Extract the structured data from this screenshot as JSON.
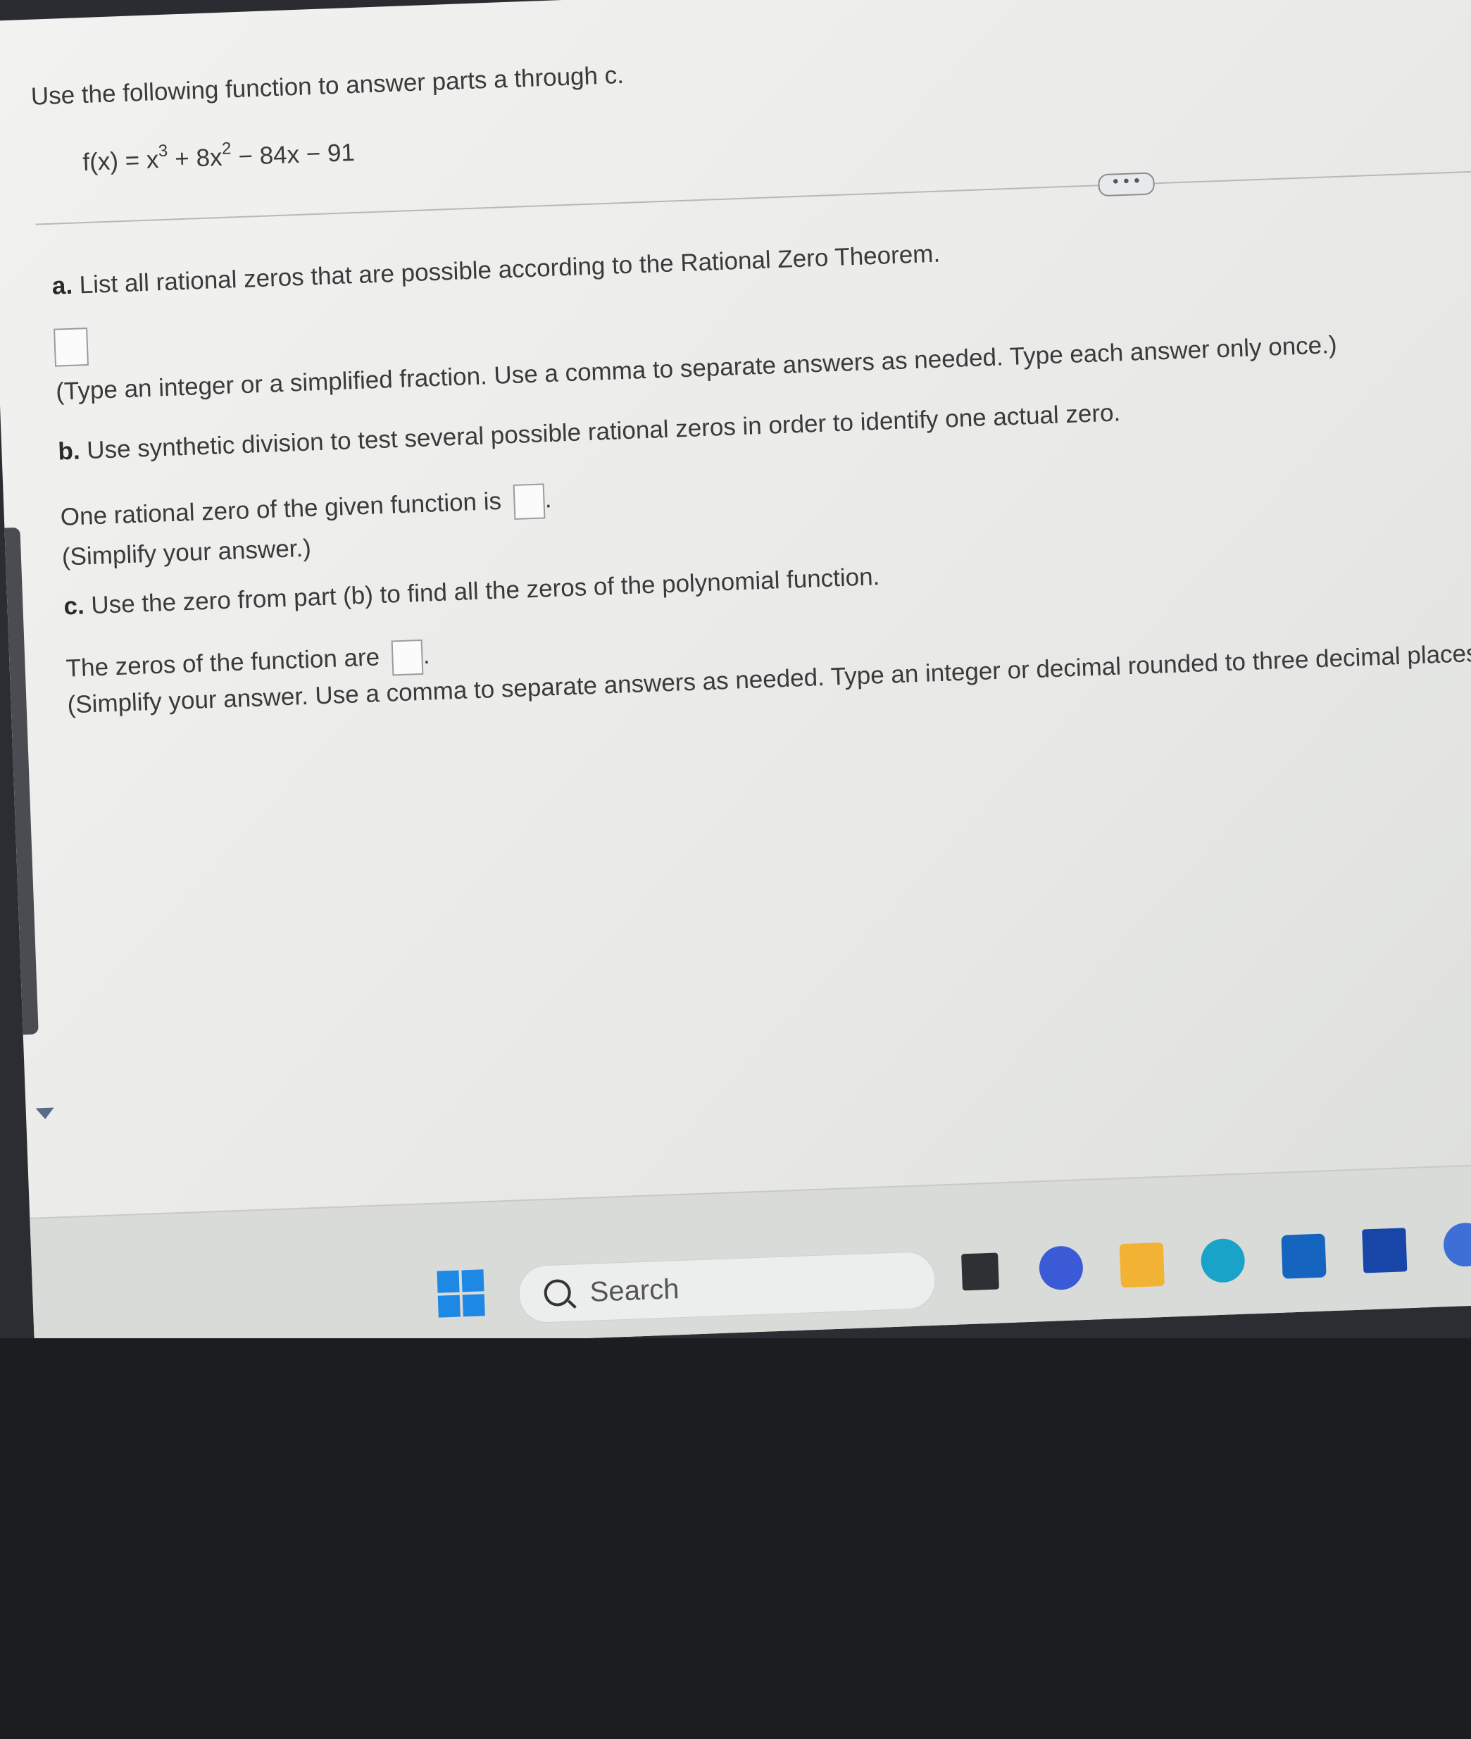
{
  "intro": "Use the following function to answer parts a through c.",
  "formula": {
    "lhs": "f(x) = x",
    "exp1": "3",
    "mid": " + 8x",
    "exp2": "2",
    "rest": " − 84x − 91"
  },
  "more_label": "• • •",
  "part_a": {
    "letter": "a.",
    "question": "List all rational zeros that are possible according to the Rational Zero Theorem.",
    "hint": "(Type an integer or a simplified fraction. Use a comma to separate answers as needed. Type each answer only once.)"
  },
  "part_b": {
    "letter": "b.",
    "question": "Use synthetic division to test several possible rational zeros in order to identify one actual zero.",
    "answer_prefix": "One rational zero of the given function is",
    "answer_suffix": ".",
    "hint": "(Simplify your answer.)"
  },
  "part_c": {
    "letter": "c.",
    "question": "Use the zero from part (b) to find all the zeros of the polynomial function.",
    "answer_prefix": "The zeros of the function are",
    "answer_suffix": ".",
    "hint": "(Simplify your answer. Use a comma to separate answers as needed. Type an integer or decimal rounded to three decimal places as n"
  },
  "taskbar": {
    "search_label": "Search"
  },
  "colors": {
    "windows_blue": "#1e88e5",
    "edge_teal": "#1aa3c9",
    "explorer_yellow": "#f2b233",
    "store_blue": "#1565c0",
    "lockdown_blue": "#1845a8"
  }
}
